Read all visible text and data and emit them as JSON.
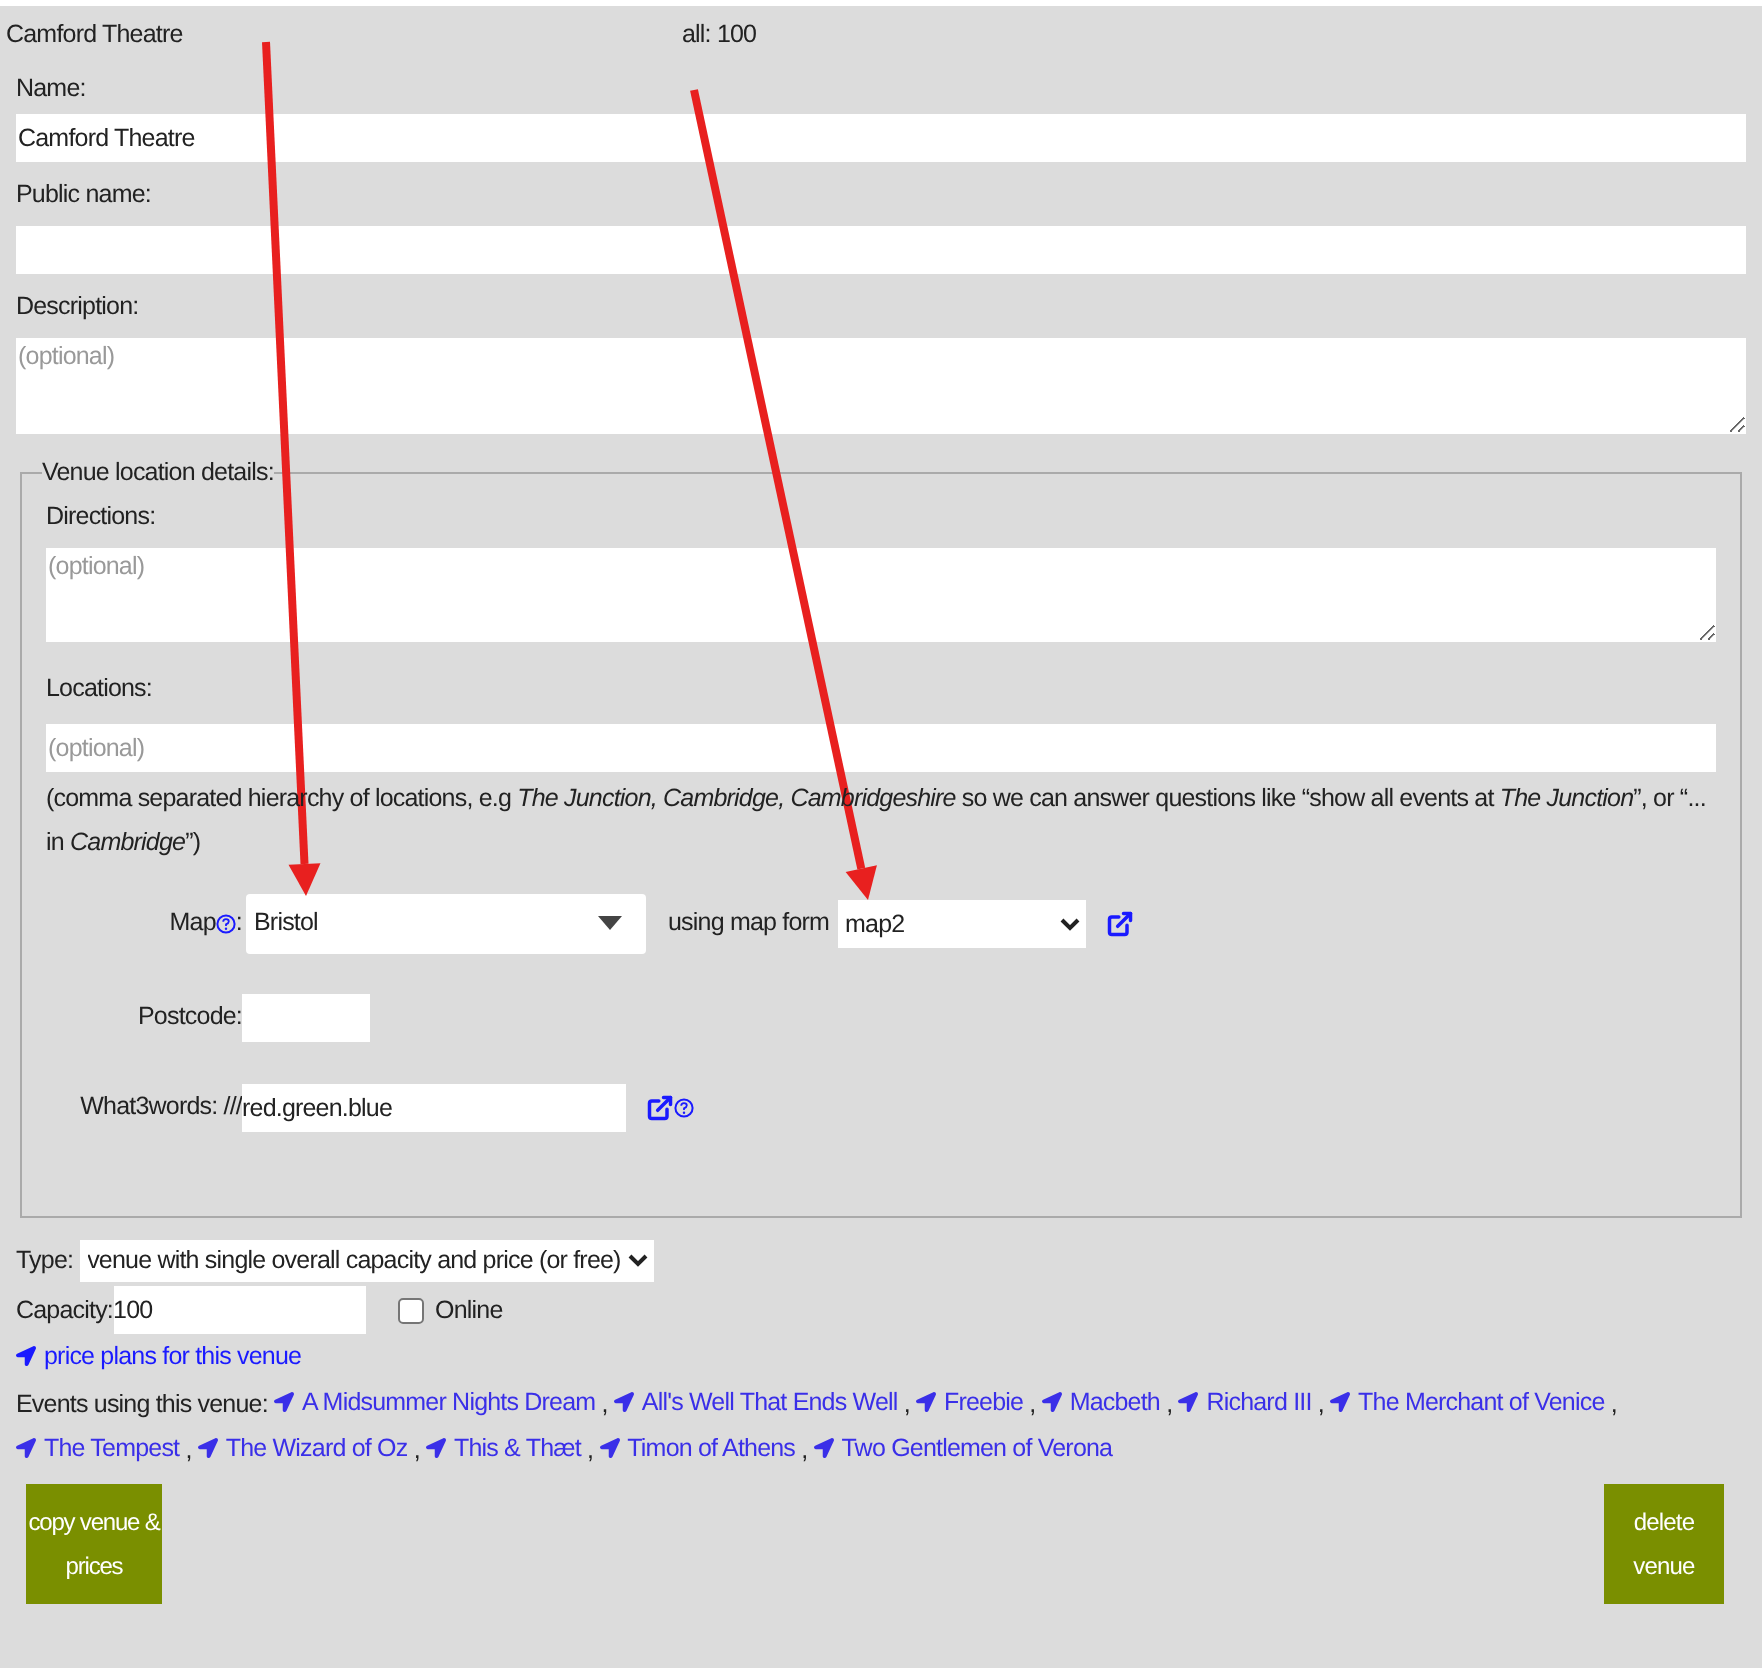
{
  "header": {
    "title": "Camford Theatre",
    "count": "all: 100"
  },
  "name": {
    "label": "Name:",
    "value": "Camford Theatre"
  },
  "public_name": {
    "label": "Public name:"
  },
  "description": {
    "label": "Description:",
    "placeholder": "(optional)"
  },
  "location": {
    "legend": "Venue location details:",
    "directions": {
      "label": "Directions:",
      "placeholder": "(optional)"
    },
    "locations": {
      "label": "Locations:",
      "placeholder": "(optional)"
    },
    "hint": "(comma separated hierarchy of locations, e.g *The Junction, Cambridge, Cambridgeshire* so we can answer questions like “show all events at *The Junction*”, or “... in *Cambridge*”)",
    "map": {
      "label": "Map",
      "separator": ":",
      "value": "Bristol",
      "form_label": "using map form",
      "form_value": "map2"
    },
    "postcode": {
      "label": "Postcode:"
    },
    "what3words": {
      "label": "What3words: ///",
      "value": "red.green.blue"
    }
  },
  "type": {
    "label": "Type:",
    "value": "venue with single overall capacity and price (or free)"
  },
  "capacity": {
    "label": "Capacity:",
    "value": "100",
    "online_label": "Online",
    "online_checked": false
  },
  "price_plans_link": "price plans for this venue",
  "events": {
    "label": "Events using this venue:",
    "separator": ",",
    "links": [
      "A Midsummer Nights Dream",
      "All's Well That Ends Well",
      "Freebie",
      "Macbeth",
      "Richard III",
      "The Merchant of Venice",
      "The Tempest",
      "The Wizard of Oz",
      "This & Thæt",
      "Timon of Athens",
      "Two Gentlemen of Verona"
    ]
  },
  "buttons": {
    "copy": "copy venue & prices",
    "delete": "delete venue"
  }
}
